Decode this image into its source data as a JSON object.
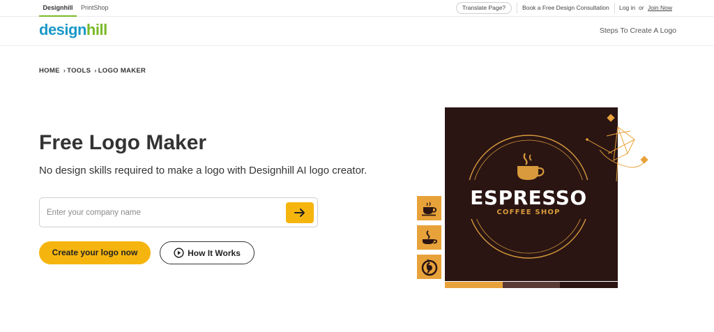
{
  "topbar": {
    "tabs": [
      {
        "label": "Designhill",
        "active": true
      },
      {
        "label": "PrintShop",
        "active": false
      }
    ],
    "translate_label": "Translate Page?",
    "consultation_label": "Book a Free Design Consultation",
    "login_label": "Log in",
    "or_label": "or",
    "join_label": "Join Now"
  },
  "header": {
    "logo_part1": "design",
    "logo_part2": "hill",
    "steps_label": "Steps To Create A Logo"
  },
  "breadcrumb": [
    "HOME",
    "TOOLS",
    "LOGO MAKER"
  ],
  "hero": {
    "title": "Free Logo Maker",
    "subtitle": "No design skills required to make a logo with Designhill AI logo creator.",
    "search_placeholder": "Enter your company name",
    "create_label": "Create your logo now",
    "how_label": "How It Works"
  },
  "preview": {
    "main_text": "ESPRESSO",
    "sub_text": "COFFEE SHOP",
    "side_icons": [
      "coffee-cup-icon",
      "coffee-steam-icon",
      "coffee-swirl-icon"
    ],
    "swatches": [
      "#e8a23a",
      "#5a3a34",
      "#2a1513"
    ]
  },
  "colors": {
    "accent": "#f6b50e",
    "brand_blue": "#1a98c7",
    "brand_green": "#7ab929",
    "gold": "#d89a3c"
  }
}
